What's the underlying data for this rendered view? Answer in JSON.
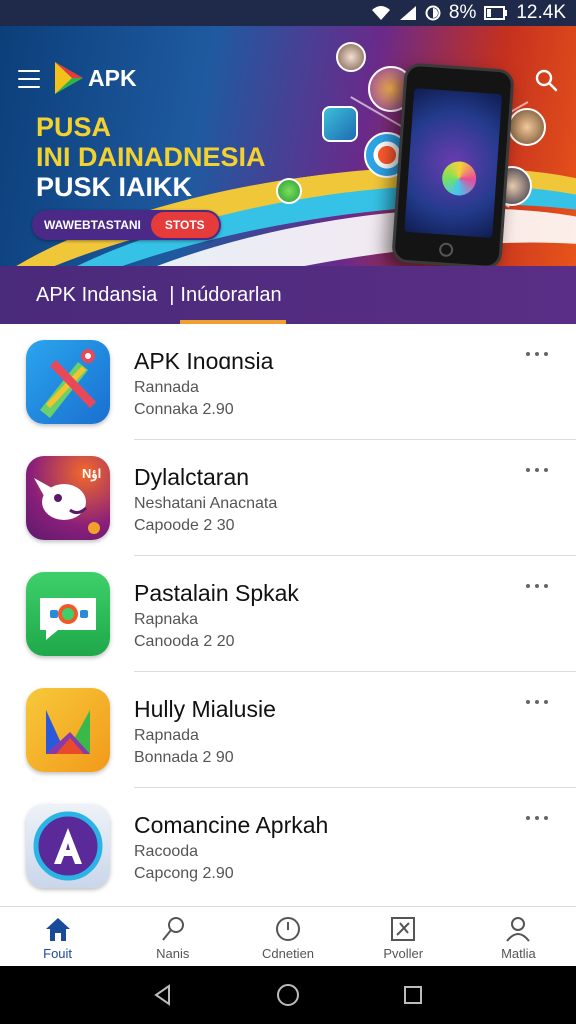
{
  "status_bar": {
    "battery": "8%",
    "time": "12.4K"
  },
  "header": {
    "logo_text": "APK"
  },
  "hero": {
    "line1": "PUSA",
    "line2": "INI DAINADNESIA",
    "line3": "PUSK IAIKK",
    "pill_text": "WAWEBTASTANI",
    "pill_button": "STOTS"
  },
  "tabs": {
    "active": "APK Indansia",
    "other": "Inúdorarlan"
  },
  "apps": [
    {
      "name": "APK Inoɑnsia",
      "sub": "Rannada",
      "version": "Connaka 2.90",
      "icon": "pen-icon"
    },
    {
      "name": "Dylalctaran",
      "sub": "Neshatani Anacnata",
      "version": "Capoode 2 30",
      "icon": "mascot-icon"
    },
    {
      "name": "Pastalain Spkak",
      "sub": "Rapnaka",
      "version": "Canooda 2 20",
      "icon": "chat-icon"
    },
    {
      "name": "Hully Mialusie",
      "sub": "Rapnada",
      "version": "Bonnada 2 90",
      "icon": "shapes-icon"
    },
    {
      "name": "Comancine Aprkah",
      "sub": "Racooda",
      "version": "Capcong 2.90",
      "icon": "letter-a-icon"
    }
  ],
  "bottom_nav": [
    {
      "label": "Fouit",
      "icon": "home-icon",
      "active": true
    },
    {
      "label": "Nanis",
      "icon": "search-tag-icon",
      "active": false
    },
    {
      "label": "Cdnetien",
      "icon": "compass-icon",
      "active": false
    },
    {
      "label": "Pvoller",
      "icon": "tools-icon",
      "active": false
    },
    {
      "label": "Matlia",
      "icon": "profile-icon",
      "active": false
    }
  ],
  "colors": {
    "accent": "#f0a030",
    "tab_bg": "#4a2a7a",
    "nav_active": "#1a4a9a"
  }
}
